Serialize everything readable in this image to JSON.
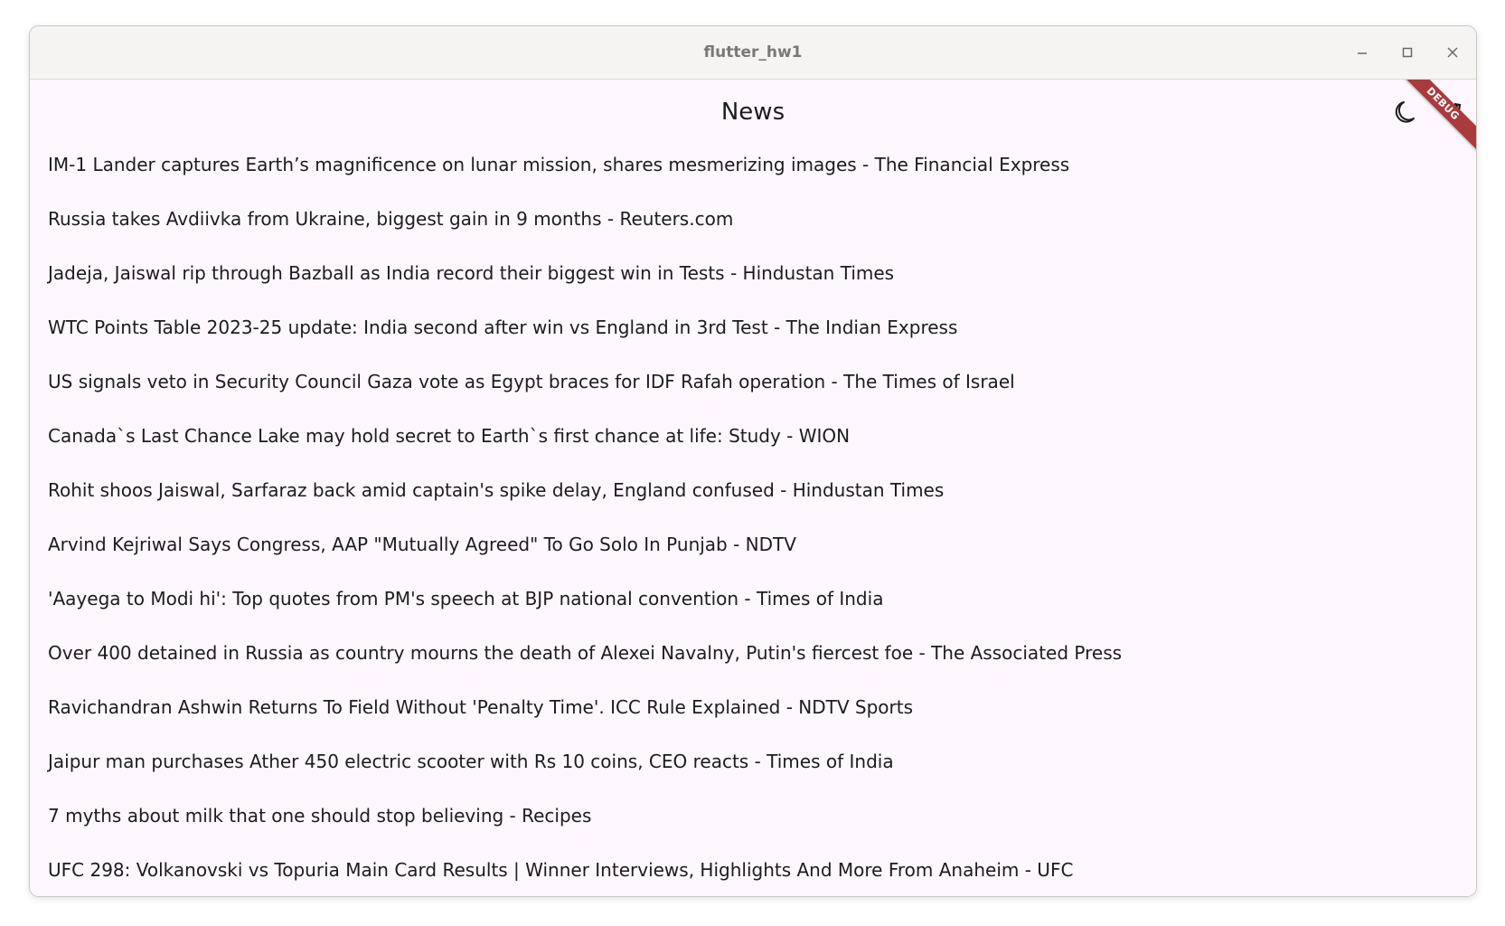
{
  "window": {
    "title": "flutter_hw1"
  },
  "appbar": {
    "title": "News",
    "theme_toggle_icon": "moon-icon",
    "refresh_icon": "refresh-icon",
    "debug_banner": "DEBUG"
  },
  "news": [
    "IM-1 Lander captures Earth’s magnificence on lunar mission, shares mesmerizing images - The Financial Express",
    "Russia takes Avdiivka from Ukraine, biggest gain in 9 months - Reuters.com",
    "Jadeja, Jaiswal rip through Bazball as India record their biggest win in Tests - Hindustan Times",
    "WTC Points Table 2023-25 update: India second after win vs England in 3rd Test - The Indian Express",
    "US signals veto in Security Council Gaza vote as Egypt braces for IDF Rafah operation - The Times of Israel",
    "Canada`s Last Chance Lake may hold secret to Earth`s first chance at life: Study - WION",
    "Rohit shoos Jaiswal, Sarfaraz back amid captain's spike delay, England confused - Hindustan Times",
    "Arvind Kejriwal Says Congress, AAP \"Mutually Agreed\" To Go Solo In Punjab - NDTV",
    "'Aayega to Modi hi': Top quotes from PM's speech at BJP national convention - Times of India",
    "Over 400 detained in Russia as country mourns the death of Alexei Navalny, Putin's fiercest foe - The Associated Press",
    "Ravichandran Ashwin Returns To Field Without 'Penalty Time'. ICC Rule Explained - NDTV Sports",
    "Jaipur man purchases Ather 450 electric scooter with Rs 10 coins, CEO reacts - Times of India",
    "7 myths about milk that one should stop believing - Recipes",
    "UFC 298: Volkanovski vs Topuria Main Card Results | Winner Interviews, Highlights And More From Anaheim - UFC"
  ]
}
